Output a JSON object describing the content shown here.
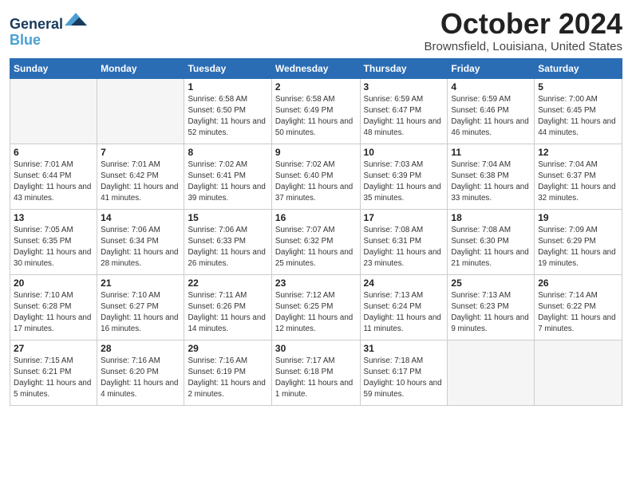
{
  "header": {
    "logo_line1": "General",
    "logo_line2": "Blue",
    "month": "October 2024",
    "location": "Brownsfield, Louisiana, United States"
  },
  "weekdays": [
    "Sunday",
    "Monday",
    "Tuesday",
    "Wednesday",
    "Thursday",
    "Friday",
    "Saturday"
  ],
  "weeks": [
    [
      {
        "day": "",
        "info": ""
      },
      {
        "day": "",
        "info": ""
      },
      {
        "day": "1",
        "info": "Sunrise: 6:58 AM\nSunset: 6:50 PM\nDaylight: 11 hours\nand 52 minutes."
      },
      {
        "day": "2",
        "info": "Sunrise: 6:58 AM\nSunset: 6:49 PM\nDaylight: 11 hours\nand 50 minutes."
      },
      {
        "day": "3",
        "info": "Sunrise: 6:59 AM\nSunset: 6:47 PM\nDaylight: 11 hours\nand 48 minutes."
      },
      {
        "day": "4",
        "info": "Sunrise: 6:59 AM\nSunset: 6:46 PM\nDaylight: 11 hours\nand 46 minutes."
      },
      {
        "day": "5",
        "info": "Sunrise: 7:00 AM\nSunset: 6:45 PM\nDaylight: 11 hours\nand 44 minutes."
      }
    ],
    [
      {
        "day": "6",
        "info": "Sunrise: 7:01 AM\nSunset: 6:44 PM\nDaylight: 11 hours\nand 43 minutes."
      },
      {
        "day": "7",
        "info": "Sunrise: 7:01 AM\nSunset: 6:42 PM\nDaylight: 11 hours\nand 41 minutes."
      },
      {
        "day": "8",
        "info": "Sunrise: 7:02 AM\nSunset: 6:41 PM\nDaylight: 11 hours\nand 39 minutes."
      },
      {
        "day": "9",
        "info": "Sunrise: 7:02 AM\nSunset: 6:40 PM\nDaylight: 11 hours\nand 37 minutes."
      },
      {
        "day": "10",
        "info": "Sunrise: 7:03 AM\nSunset: 6:39 PM\nDaylight: 11 hours\nand 35 minutes."
      },
      {
        "day": "11",
        "info": "Sunrise: 7:04 AM\nSunset: 6:38 PM\nDaylight: 11 hours\nand 33 minutes."
      },
      {
        "day": "12",
        "info": "Sunrise: 7:04 AM\nSunset: 6:37 PM\nDaylight: 11 hours\nand 32 minutes."
      }
    ],
    [
      {
        "day": "13",
        "info": "Sunrise: 7:05 AM\nSunset: 6:35 PM\nDaylight: 11 hours\nand 30 minutes."
      },
      {
        "day": "14",
        "info": "Sunrise: 7:06 AM\nSunset: 6:34 PM\nDaylight: 11 hours\nand 28 minutes."
      },
      {
        "day": "15",
        "info": "Sunrise: 7:06 AM\nSunset: 6:33 PM\nDaylight: 11 hours\nand 26 minutes."
      },
      {
        "day": "16",
        "info": "Sunrise: 7:07 AM\nSunset: 6:32 PM\nDaylight: 11 hours\nand 25 minutes."
      },
      {
        "day": "17",
        "info": "Sunrise: 7:08 AM\nSunset: 6:31 PM\nDaylight: 11 hours\nand 23 minutes."
      },
      {
        "day": "18",
        "info": "Sunrise: 7:08 AM\nSunset: 6:30 PM\nDaylight: 11 hours\nand 21 minutes."
      },
      {
        "day": "19",
        "info": "Sunrise: 7:09 AM\nSunset: 6:29 PM\nDaylight: 11 hours\nand 19 minutes."
      }
    ],
    [
      {
        "day": "20",
        "info": "Sunrise: 7:10 AM\nSunset: 6:28 PM\nDaylight: 11 hours\nand 17 minutes."
      },
      {
        "day": "21",
        "info": "Sunrise: 7:10 AM\nSunset: 6:27 PM\nDaylight: 11 hours\nand 16 minutes."
      },
      {
        "day": "22",
        "info": "Sunrise: 7:11 AM\nSunset: 6:26 PM\nDaylight: 11 hours\nand 14 minutes."
      },
      {
        "day": "23",
        "info": "Sunrise: 7:12 AM\nSunset: 6:25 PM\nDaylight: 11 hours\nand 12 minutes."
      },
      {
        "day": "24",
        "info": "Sunrise: 7:13 AM\nSunset: 6:24 PM\nDaylight: 11 hours\nand 11 minutes."
      },
      {
        "day": "25",
        "info": "Sunrise: 7:13 AM\nSunset: 6:23 PM\nDaylight: 11 hours\nand 9 minutes."
      },
      {
        "day": "26",
        "info": "Sunrise: 7:14 AM\nSunset: 6:22 PM\nDaylight: 11 hours\nand 7 minutes."
      }
    ],
    [
      {
        "day": "27",
        "info": "Sunrise: 7:15 AM\nSunset: 6:21 PM\nDaylight: 11 hours\nand 5 minutes."
      },
      {
        "day": "28",
        "info": "Sunrise: 7:16 AM\nSunset: 6:20 PM\nDaylight: 11 hours\nand 4 minutes."
      },
      {
        "day": "29",
        "info": "Sunrise: 7:16 AM\nSunset: 6:19 PM\nDaylight: 11 hours\nand 2 minutes."
      },
      {
        "day": "30",
        "info": "Sunrise: 7:17 AM\nSunset: 6:18 PM\nDaylight: 11 hours\nand 1 minute."
      },
      {
        "day": "31",
        "info": "Sunrise: 7:18 AM\nSunset: 6:17 PM\nDaylight: 10 hours\nand 59 minutes."
      },
      {
        "day": "",
        "info": ""
      },
      {
        "day": "",
        "info": ""
      }
    ]
  ]
}
